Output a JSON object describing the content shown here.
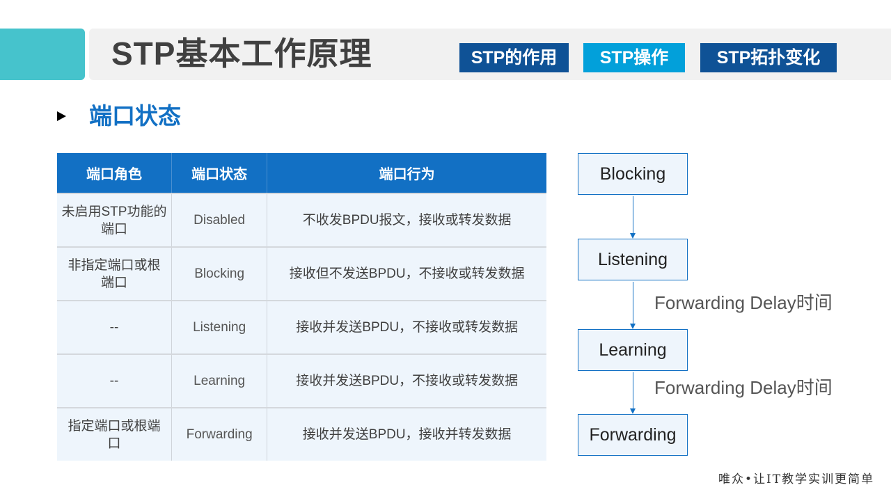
{
  "header": {
    "title": "STP基本工作原理",
    "nav_tabs": [
      {
        "label": "STP的作用",
        "color": "#0f5296",
        "active": false
      },
      {
        "label": "STP操作",
        "color": "#02a0da",
        "active": true
      },
      {
        "label": "STP拓扑变化",
        "color": "#0f5296",
        "active": false
      }
    ]
  },
  "section": {
    "bullet_icon": "triangle-right",
    "title": "端口状态"
  },
  "table": {
    "headers": [
      "端口角色",
      "端口状态",
      "端口行为"
    ],
    "rows": [
      {
        "role": "未启用STP功能的端口",
        "state": "Disabled",
        "behavior": "不收发BPDU报文，接收或转发数据"
      },
      {
        "role": "非指定端口或根端口",
        "state": "Blocking",
        "behavior": "接收但不发送BPDU，不接收或转发数据"
      },
      {
        "role": "--",
        "state": "Listening",
        "behavior": "接收并发送BPDU，不接收或转发数据"
      },
      {
        "role": "--",
        "state": "Learning",
        "behavior": "接收并发送BPDU，不接收或转发数据"
      },
      {
        "role": "指定端口或根端口",
        "state": "Forwarding",
        "behavior": "接收并发送BPDU，接收并转发数据"
      }
    ]
  },
  "flow": {
    "states": [
      "Blocking",
      "Listening",
      "Learning",
      "Forwarding"
    ],
    "transition_labels": [
      "",
      "Forwarding Delay时间",
      "Forwarding Delay时间"
    ]
  },
  "footer": {
    "slogan": "唯众•让IT教学实训更简单"
  },
  "colors": {
    "accent_teal": "#46c3cc",
    "primary_blue": "#1270c4",
    "nav_dark": "#0f5296",
    "nav_active": "#02a0da",
    "cell_bg": "#eef5fc"
  }
}
